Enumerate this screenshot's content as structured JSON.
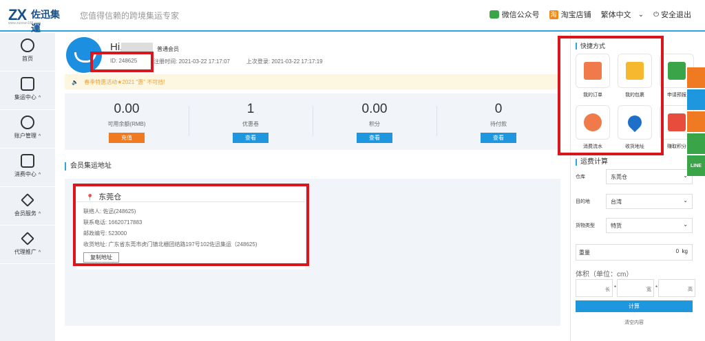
{
  "header": {
    "logo_mark": "ZX",
    "logo_name": "佐迅集運",
    "logo_url": "www.zuoxun188.com",
    "slogan": "您值得信赖的跨境集运专家",
    "wechat": "微信公众号",
    "taobao": "淘宝店铺",
    "taobao_glyph": "淘",
    "language": "繁体中文",
    "chevron": "⌄",
    "power_glyph": "⏻",
    "logout": "安全退出"
  },
  "sidebar": {
    "items": [
      {
        "label": "首页",
        "icon": "home-icon"
      },
      {
        "label": "集运中心",
        "icon": "box-icon"
      },
      {
        "label": "账户管理",
        "icon": "user-icon"
      },
      {
        "label": "消费中心",
        "icon": "card-icon"
      },
      {
        "label": "会员服务",
        "icon": "diamond-icon"
      },
      {
        "label": "代理推广",
        "icon": "diamond-icon"
      }
    ],
    "arrow": "^"
  },
  "profile": {
    "greeting": "Hi,",
    "level": "普通会员",
    "id": "ID: 248625",
    "register": "注册时间: 2021-03-22 17:17:07",
    "last_login": "上次登录: 2021-03-22 17:17:19"
  },
  "notice": {
    "icon": "speaker-icon",
    "speaker_glyph": "🔈",
    "text": "春季特惠活动★2021 \"惠\" 不可挡!"
  },
  "stats": [
    {
      "value": "0.00",
      "label": "可用余额(RMB)",
      "button": "充值"
    },
    {
      "value": "1",
      "label": "优惠卷",
      "button": "查看"
    },
    {
      "value": "0.00",
      "label": "积分",
      "button": "查看"
    },
    {
      "value": "0",
      "label": "待付款",
      "button": "查看"
    }
  ],
  "address": {
    "section_title": "会员集运地址",
    "pin_glyph": "📍",
    "warehouse": "东莞仓",
    "contact": "联络人:  佐迅(248625)",
    "phone": "联系电话:  16620717883",
    "postcode": "邮政编号:  523000",
    "receive": "收货地址:  广东省东莞市虎门镇北栅团结路197号102佐迅集运（248625)",
    "copy_button": "复制地址"
  },
  "quick": {
    "title": "快捷方式",
    "items": [
      {
        "label": "我的订单",
        "icon": "order-icon",
        "color": "#f07a4a"
      },
      {
        "label": "我的包裹",
        "icon": "package-icon",
        "color": "#f5b82e"
      },
      {
        "label": "申请预报",
        "icon": "truck-icon",
        "color": "#39a548"
      },
      {
        "label": "消费流水",
        "icon": "pie-chart-icon",
        "color": "#f07a4a"
      },
      {
        "label": "收货地址",
        "icon": "location-icon",
        "color": "#1e6fc8"
      },
      {
        "label": "赚取积分",
        "icon": "gift-icon",
        "color": "#e84c3d"
      }
    ]
  },
  "calculator": {
    "title": "运费计算",
    "warehouse_label": "仓库",
    "warehouse_value": "东莞仓",
    "dest_label": "目的地",
    "dest_value": "台湾",
    "type_label": "货物类型",
    "type_value": "特货",
    "weight_label": "重量",
    "weight_value": "0",
    "weight_unit": "kg",
    "volume_title": "体积（单位：cm）",
    "length": "长",
    "width": "宽",
    "height": "高",
    "star": "*",
    "calc_button": "计算",
    "clear": "清空内容",
    "select_chevron": "⌄"
  },
  "float_bar": {
    "line_label": "LINE"
  }
}
